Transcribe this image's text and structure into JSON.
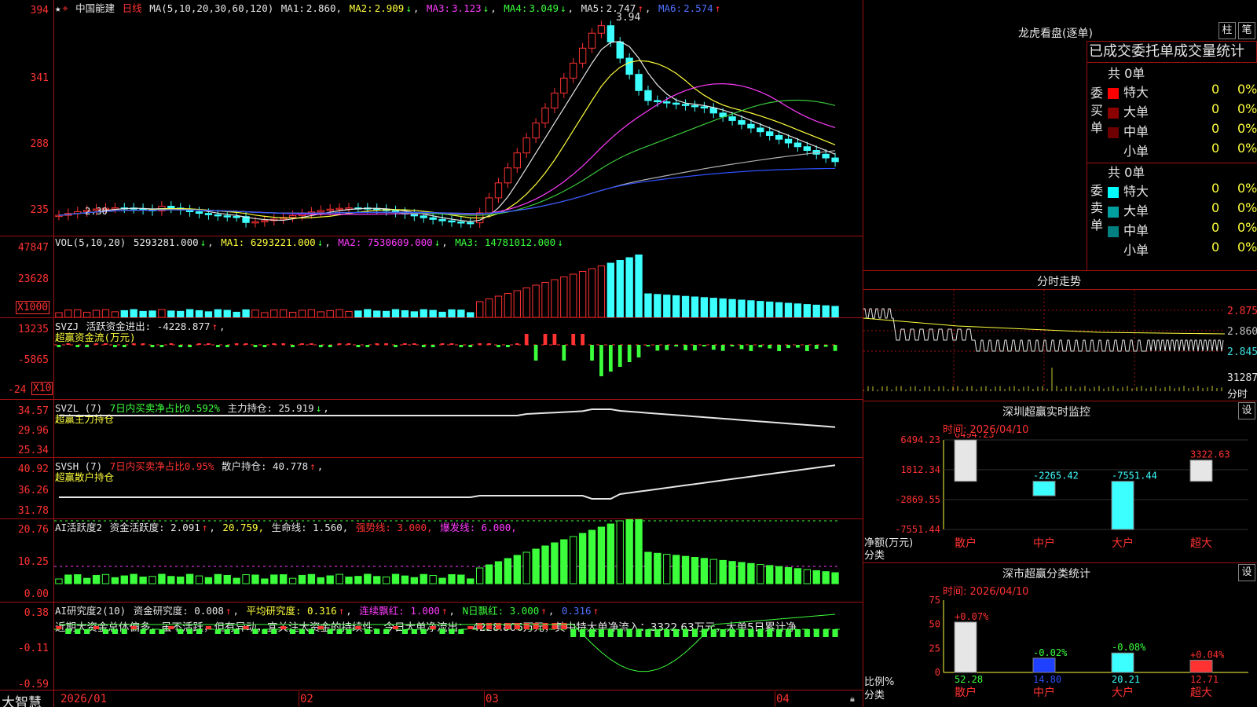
{
  "stock": {
    "name": "中国能建",
    "period": "日线"
  },
  "main_header": {
    "ma_def": "MA(5,10,20,30,60,120)",
    "ma1_label": "MA1:",
    "ma1": "2.860,",
    "ma2_label": "MA2:",
    "ma2": "2.909",
    "ma3_label": "MA3:",
    "ma3": "3.123",
    "ma4_label": "MA4:",
    "ma4": "3.049",
    "ma5_label": "MA5:",
    "ma5": "2.747",
    "ma6_label": "MA6:",
    "ma6": "2.574",
    "arrow_up": "↑",
    "arrow_down": "↓",
    "comma": ","
  },
  "main_axis": [
    "394",
    "341",
    "288",
    "235"
  ],
  "price_hi": "3.94",
  "price_lo": "2.30",
  "vol_header": {
    "def": "VOL(5,10,20)",
    "v": "5293281.000",
    "ma1": "MA1: 6293221.000",
    "ma2": "MA2: 7530609.000",
    "ma3": "MA3: 14781012.000"
  },
  "vol_axis": [
    "47847",
    "23628"
  ],
  "vol_unit": "X1000",
  "svzj": {
    "name": "SVZJ",
    "desc": "活跃资金进出: -4228.877",
    "sub": "超赢资金流(万元)",
    "axis": [
      "13235",
      "-5865",
      "-24"
    ],
    "unit": "X10"
  },
  "svzl": {
    "name": "SVZL (7)",
    "desc": "7日内买卖净占比0.592%",
    "hold": "主力持仓: 25.919",
    "sub": "超赢主力持仓",
    "axis": [
      "34.57",
      "29.96",
      "25.34"
    ]
  },
  "svsh": {
    "name": "SVSH (7)",
    "desc": "7日内买卖净占比0.95%",
    "hold": "散户持仓: 40.778",
    "sub": "超赢散户持仓",
    "axis": [
      "40.92",
      "36.26",
      "31.78"
    ]
  },
  "ai2": {
    "name": "AI活跃度2",
    "a": "资金活跃度: 2.091",
    "b": "20.759,",
    "c": "生命线: 1.560,",
    "d": "强势线: 3.000,",
    "e": "爆发线: 6.000,",
    "axis": [
      "20.76",
      "10.25",
      "0.00"
    ]
  },
  "ai_res": {
    "name": "AI研究度2(10)",
    "a": "资金研究度: 0.008",
    "b": "平均研究度: 0.316",
    "c": "连续飘红: 1.000",
    "d": "N日飘红: 3.000",
    "e": "0.316",
    "axis": [
      "0.38",
      "-0.11",
      "-0.59"
    ]
  },
  "commentary": "近期大资金总体偏多，虽不活跃，但有异动，宜关注大资金的持续性，今日大单净流出：-4228.806万元，其中特大单净流入：3322.63万元，大单5日累计净",
  "date_axis": [
    "2026/01",
    "02",
    "03",
    "04"
  ],
  "brand": "大智慧",
  "dragon": {
    "title": "龙虎看盘(逐单)",
    "btn_zhu": "柱",
    "btn_bi": "笔",
    "tabs": [
      "已成交",
      "委托单",
      "成交量统计"
    ],
    "buy_label": "委买单",
    "sell_label": "委卖单",
    "buy_total": "共 0单",
    "sell_total": "共 0单",
    "buy_rows": [
      {
        "label": "特大",
        "color": "#ff0000",
        "v": "0",
        "p": "0%"
      },
      {
        "label": "大单",
        "color": "#8b0000",
        "v": "0",
        "p": "0%"
      },
      {
        "label": "中单",
        "color": "#6e0000",
        "v": "0",
        "p": "0%"
      },
      {
        "label": "小单",
        "color": "#000000",
        "v": "0",
        "p": "0%"
      }
    ],
    "sell_rows": [
      {
        "label": "特大",
        "color": "#00ffff",
        "v": "0",
        "p": "0%"
      },
      {
        "label": "大单",
        "color": "#00a0a0",
        "v": "0",
        "p": "0%"
      },
      {
        "label": "中单",
        "color": "#008080",
        "v": "0",
        "p": "0%"
      },
      {
        "label": "小单",
        "color": "#000000",
        "v": "0",
        "p": "0%"
      }
    ]
  },
  "intraday": {
    "title": "分时走势",
    "axis": [
      "2.875",
      "2.860",
      "2.845"
    ],
    "vol": "31287",
    "unit": "分时"
  },
  "sz_monitor": {
    "title": "深圳超赢实时监控",
    "btn": "设",
    "date_label": "时间: 2026/04/10",
    "axis": [
      "6494.23",
      "1812.34",
      "-2869.55",
      "-7551.44"
    ],
    "ylabel": "净额(万元)",
    "xlabel": "分类",
    "cats": [
      "散户",
      "中户",
      "大户",
      "超大"
    ],
    "values": [
      6494.23,
      -2265.42,
      -7551.44,
      3322.63
    ],
    "labels": [
      "6494.23",
      "-2265.42",
      "-7551.44",
      "3322.63"
    ]
  },
  "sz_class": {
    "title": "深市超赢分类统计",
    "btn": "设",
    "date_label": "时间: 2026/04/10",
    "axis": [
      "75",
      "50",
      "25",
      "0"
    ],
    "ylabel": "比例%",
    "xlabel": "分类",
    "cats": [
      "散户",
      "中户",
      "大户",
      "超大"
    ],
    "values": [
      52.28,
      14.8,
      20.21,
      12.71
    ],
    "vals_text": [
      "52.28",
      "14.80",
      "20.21",
      "12.71"
    ],
    "changes": [
      "+0.07%",
      "-0.02%",
      "-0.08%",
      "+0.04%"
    ]
  },
  "chart_data": {
    "type": "bar",
    "categories": [
      "散户",
      "中户",
      "大户",
      "超大"
    ],
    "series": [
      {
        "name": "净额(万元)",
        "values": [
          6494.23,
          -2265.42,
          -7551.44,
          3322.63
        ]
      },
      {
        "name": "比例%",
        "values": [
          52.28,
          14.8,
          20.21,
          12.71
        ]
      }
    ]
  }
}
